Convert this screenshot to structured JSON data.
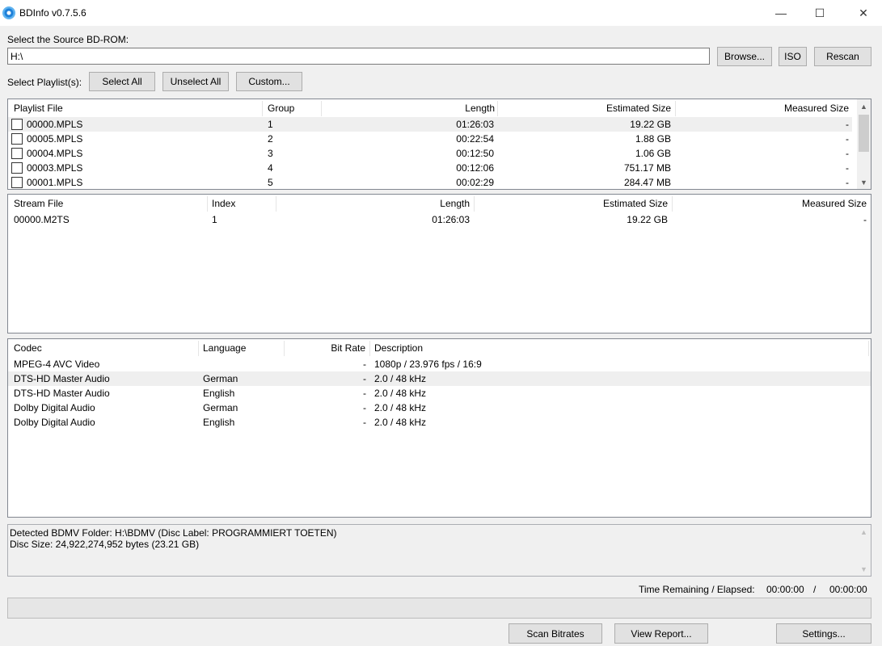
{
  "window": {
    "title": "BDInfo v0.7.5.6",
    "minimize_glyph": "—",
    "maximize_glyph": "☐",
    "close_glyph": "✕"
  },
  "source": {
    "label": "Select the Source BD-ROM:",
    "value": "H:\\",
    "browse_label": "Browse...",
    "iso_label": "ISO",
    "rescan_label": "Rescan"
  },
  "playlist_select": {
    "label": "Select Playlist(s):",
    "select_all_label": "Select All",
    "unselect_all_label": "Unselect All",
    "custom_label": "Custom..."
  },
  "playlists": {
    "headers": {
      "file": "Playlist File",
      "group": "Group",
      "length": "Length",
      "estimated": "Estimated Size",
      "measured": "Measured Size"
    },
    "rows": [
      {
        "file": "00000.MPLS",
        "group": "1",
        "length": "01:26:03",
        "estimated": "19.22 GB",
        "measured": "-",
        "checked": false
      },
      {
        "file": "00005.MPLS",
        "group": "2",
        "length": "00:22:54",
        "estimated": "1.88 GB",
        "measured": "-",
        "checked": false
      },
      {
        "file": "00004.MPLS",
        "group": "3",
        "length": "00:12:50",
        "estimated": "1.06 GB",
        "measured": "-",
        "checked": false
      },
      {
        "file": "00003.MPLS",
        "group": "4",
        "length": "00:12:06",
        "estimated": "751.17 MB",
        "measured": "-",
        "checked": false
      },
      {
        "file": "00001.MPLS",
        "group": "5",
        "length": "00:02:29",
        "estimated": "284.47 MB",
        "measured": "-",
        "checked": false
      }
    ]
  },
  "streams": {
    "headers": {
      "file": "Stream File",
      "index": "Index",
      "length": "Length",
      "estimated": "Estimated Size",
      "measured": "Measured Size"
    },
    "rows": [
      {
        "file": "00000.M2TS",
        "index": "1",
        "length": "01:26:03",
        "estimated": "19.22 GB",
        "measured": "-"
      }
    ]
  },
  "codecs": {
    "headers": {
      "codec": "Codec",
      "language": "Language",
      "bitrate": "Bit Rate",
      "description": "Description"
    },
    "rows": [
      {
        "codec": "MPEG-4 AVC Video",
        "language": "",
        "bitrate": "-",
        "description": "1080p / 23.976 fps / 16:9"
      },
      {
        "codec": "DTS-HD Master Audio",
        "language": "German",
        "bitrate": "-",
        "description": "2.0 / 48 kHz"
      },
      {
        "codec": "DTS-HD Master Audio",
        "language": "English",
        "bitrate": "-",
        "description": "2.0 / 48 kHz"
      },
      {
        "codec": "Dolby Digital Audio",
        "language": "German",
        "bitrate": "-",
        "description": "2.0 / 48 kHz"
      },
      {
        "codec": "Dolby Digital Audio",
        "language": "English",
        "bitrate": "-",
        "description": "2.0 / 48 kHz"
      }
    ]
  },
  "log": {
    "lines": [
      "Detected BDMV Folder: H:\\BDMV (Disc Label: PROGRAMMIERT TOETEN)",
      "Disc Size: 24,922,274,952 bytes (23.21 GB)"
    ]
  },
  "status": {
    "time_label": "Time Remaining / Elapsed:",
    "remaining": "00:00:00",
    "separator": "/",
    "elapsed": "00:00:00",
    "progress": 0
  },
  "footer": {
    "scan_label": "Scan Bitrates",
    "report_label": "View Report...",
    "settings_label": "Settings..."
  },
  "icons": {
    "app": "bluray-disc-icon",
    "scroll_up": "chevron-up-icon",
    "scroll_down": "chevron-down-icon"
  }
}
